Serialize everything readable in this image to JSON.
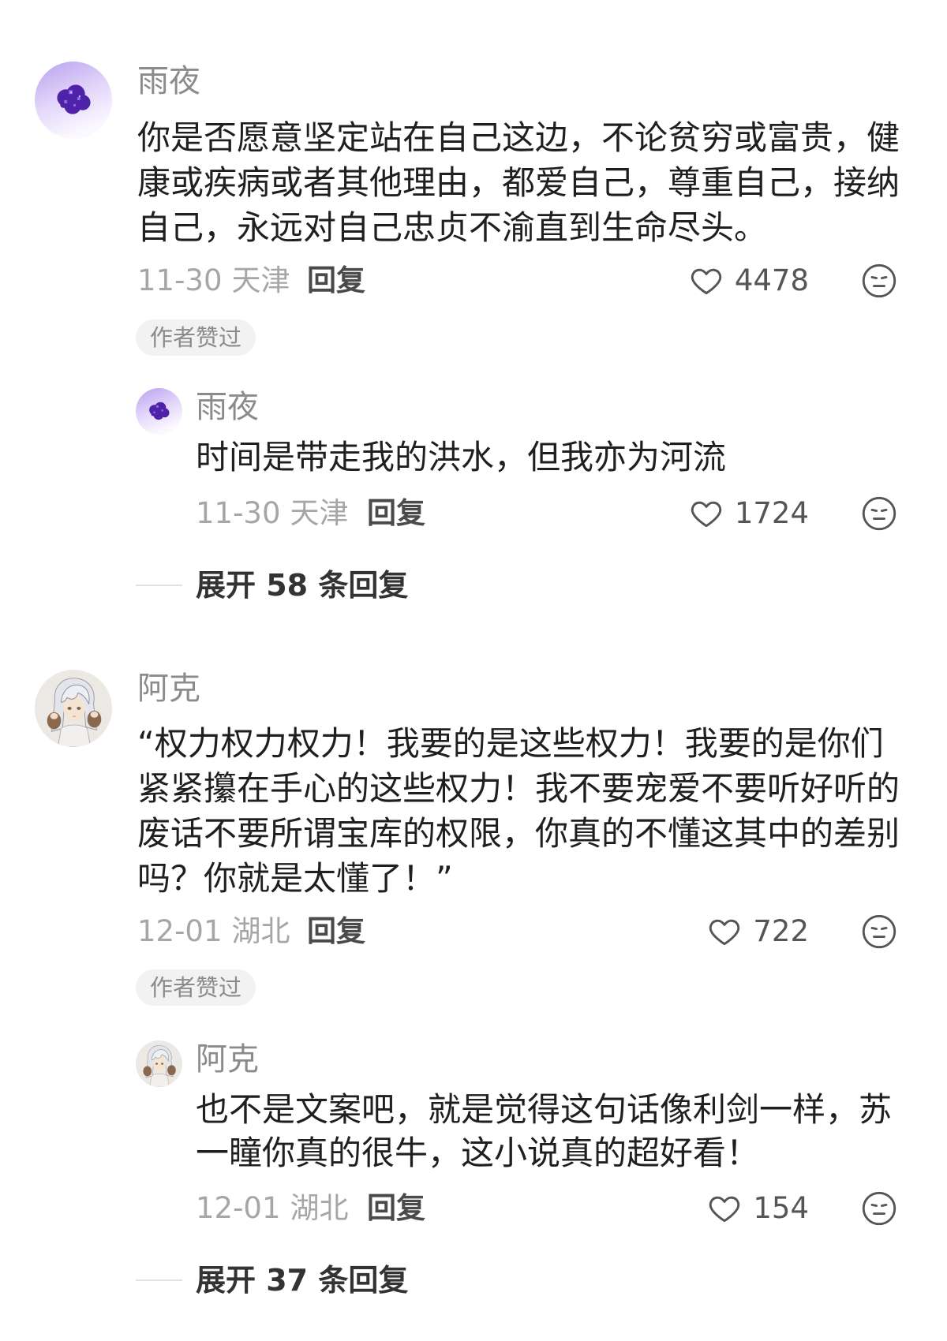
{
  "comments": [
    {
      "user": {
        "name": "雨夜",
        "avatar": "purple-gem-avatar"
      },
      "text_lines": [
        "你是否愿意坚定站在自己这边，不论贫穷或富贵，健",
        "康或疾病或者其他理由，都爱自己，尊重自己，接纳",
        "自己，永远对自己忠贞不渝直到生命尽头。"
      ],
      "date": "11-30",
      "location": "天津",
      "reply_label": "回复",
      "likes": "4478",
      "badge": "作者赞过",
      "reply": {
        "user": {
          "name": "雨夜",
          "avatar": "purple-gem-avatar"
        },
        "text_lines": [
          "时间是带走我的洪水，但我亦为河流"
        ],
        "date": "11-30",
        "location": "天津",
        "reply_label": "回复",
        "likes": "1724"
      },
      "expand_label": "展开 58 条回复"
    },
    {
      "user": {
        "name": "阿克",
        "avatar": "silver-hair-anime-avatar"
      },
      "text_lines": [
        "“权力权力权力！我要的是这些权力！我要的是你们",
        "紧紧攥在手心的这些权力！我不要宠爱不要听好听的",
        "废话不要所谓宝库的权限，你真的不懂这其中的差别",
        "吗？你就是太懂了！”"
      ],
      "date": "12-01",
      "location": "湖北",
      "reply_label": "回复",
      "likes": "722",
      "badge": "作者赞过",
      "reply": {
        "user": {
          "name": "阿克",
          "avatar": "silver-hair-anime-avatar"
        },
        "text_lines": [
          "也不是文案吧，就是觉得这句话像利剑一样，苏",
          "一瞳你真的很牛，这小说真的超好看！"
        ],
        "date": "12-01",
        "location": "湖北",
        "reply_label": "回复",
        "likes": "154"
      },
      "expand_label": "展开 37 条回复"
    }
  ],
  "icons": {
    "like": "heart-outline-icon",
    "dislike": "neutral-face-icon"
  },
  "colors": {
    "background": "#ffffff",
    "username": "#8b8b8b",
    "body_text": "#1f1f1f",
    "meta_text": "#a6a6a6",
    "reply_link": "#4a4a4a",
    "badge_bg": "#f2f2f2",
    "badge_text": "#8a8a8a",
    "icon_stroke": "#555555",
    "avatar_purple": "#4f23a8"
  }
}
